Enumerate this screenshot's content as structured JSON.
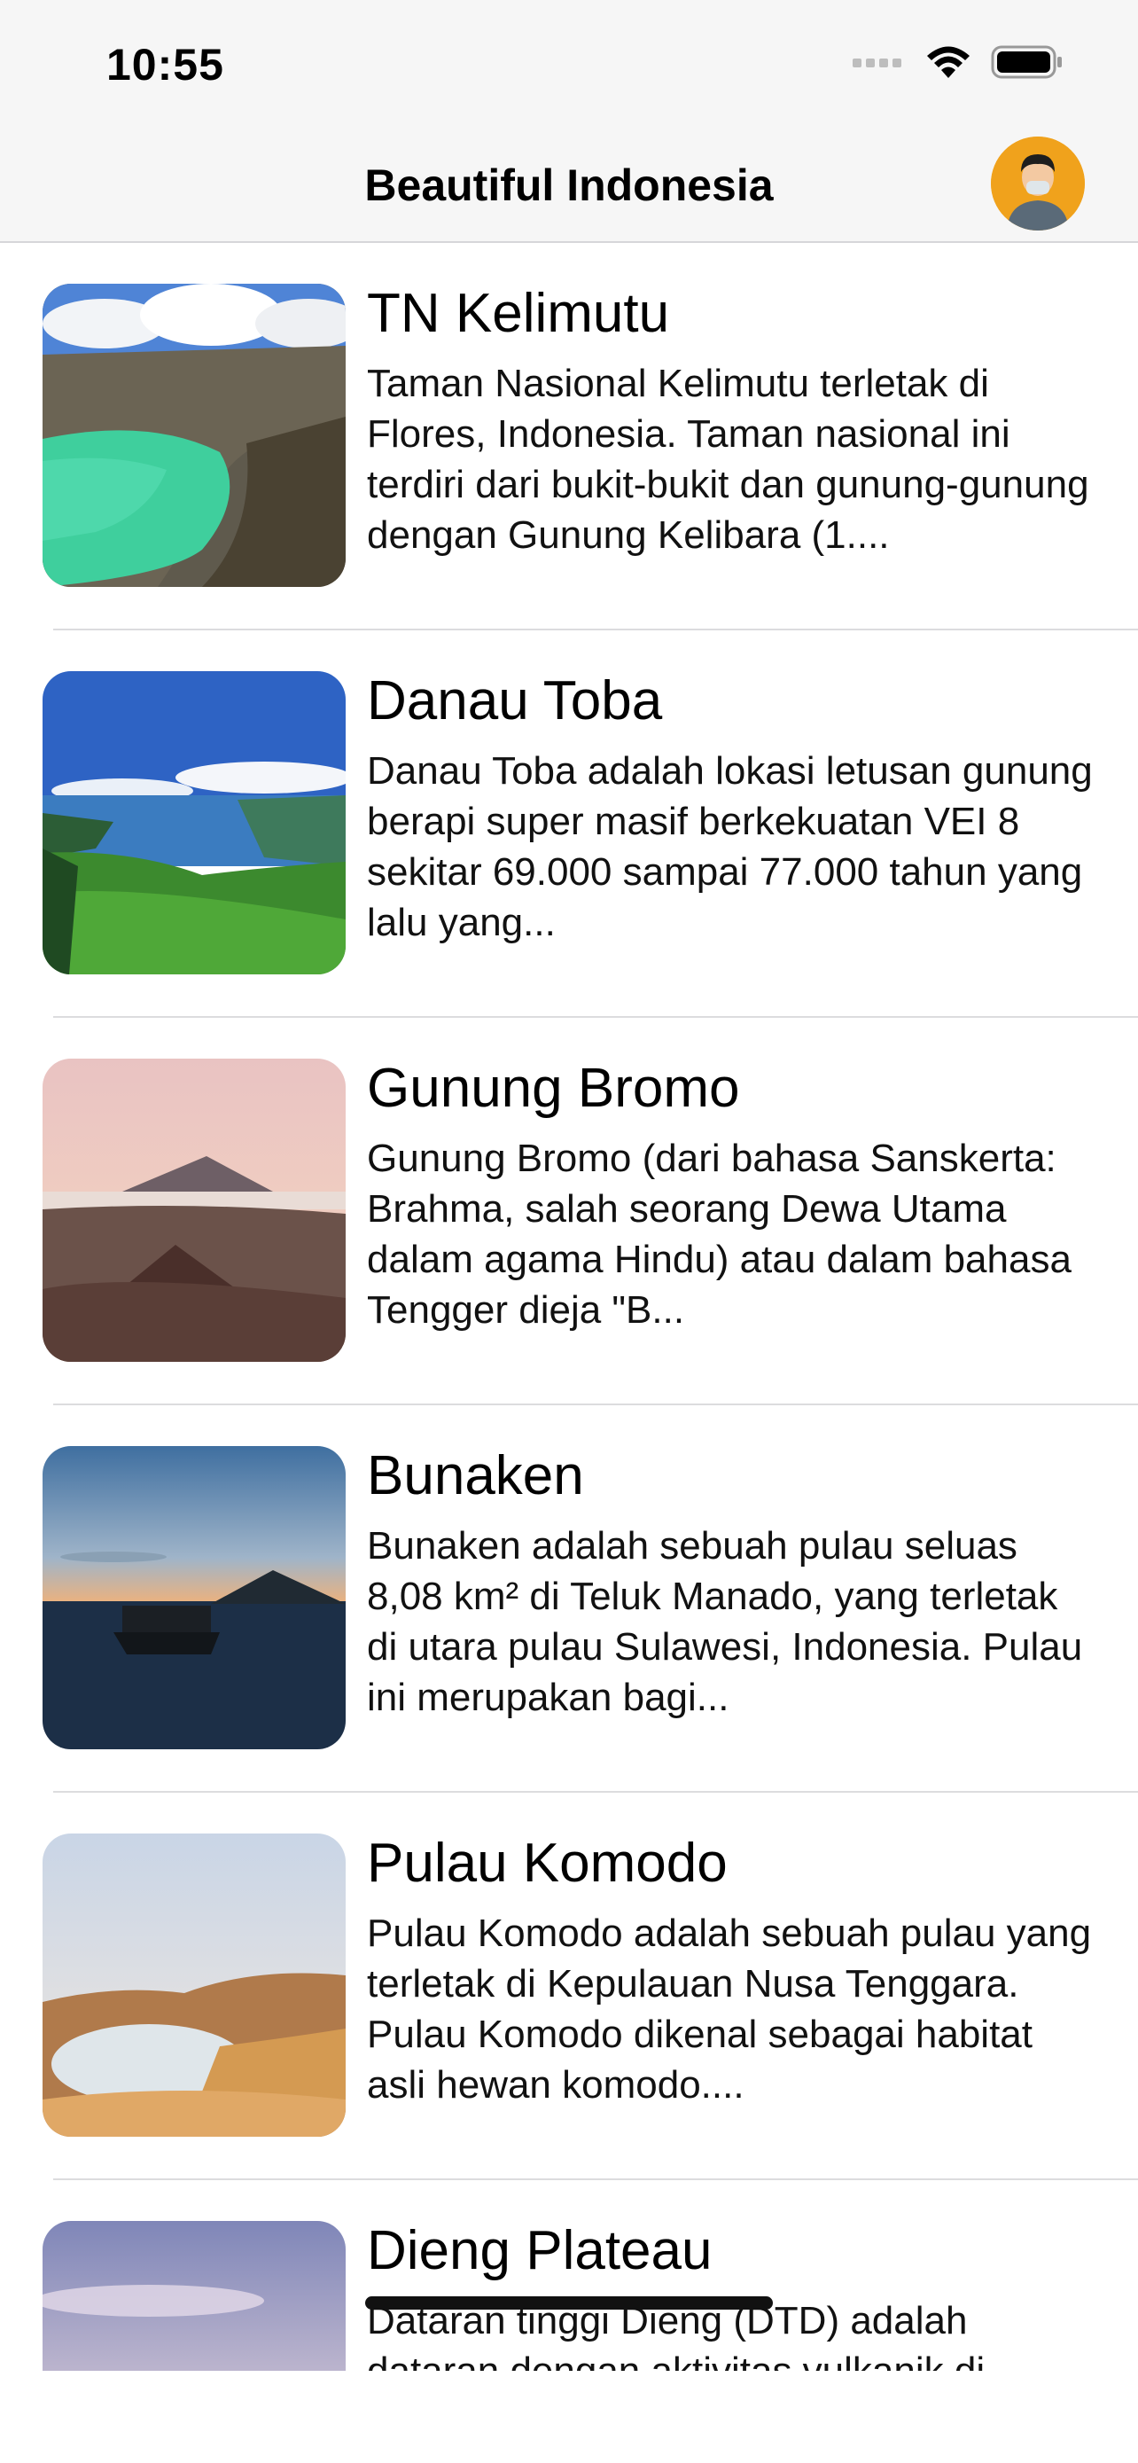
{
  "status_bar": {
    "time": "10:55"
  },
  "nav": {
    "title": "Beautiful Indonesia"
  },
  "items": [
    {
      "title": "TN Kelimutu",
      "description": "Taman Nasional Kelimutu terletak di Flores, Indonesia. Taman nasional ini terdiri dari bukit-bukit dan gunung-gunung dengan Gunung Kelibara (1....",
      "image": "kelimutu-crater-lake"
    },
    {
      "title": "Danau Toba",
      "description": "Danau Toba adalah lokasi letusan gunung berapi super masif berkekuatan VEI 8 sekitar 69.000 sampai 77.000 tahun yang lalu yang...",
      "image": "toba-lake"
    },
    {
      "title": "Gunung Bromo",
      "description": "Gunung Bromo (dari bahasa Sanskerta: Brahma, salah seorang Dewa Utama dalam agama Hindu) atau dalam bahasa Tengger dieja \"B...",
      "image": "bromo-volcano"
    },
    {
      "title": "Bunaken",
      "description": "Bunaken adalah sebuah pulau seluas 8,08 km² di Teluk Manado, yang terletak di utara pulau Sulawesi, Indonesia. Pulau ini merupakan bagi...",
      "image": "bunaken-boat-sunset"
    },
    {
      "title": "Pulau Komodo",
      "description": "Pulau Komodo adalah sebuah pulau yang terletak di Kepulauan Nusa Tenggara. Pulau Komodo dikenal sebagai habitat asli hewan komodo....",
      "image": "komodo-hills"
    },
    {
      "title": "Dieng Plateau",
      "description": "Dataran tinggi Dieng (DTD) adalah dataran dengan aktivitas vulkanik di bawah permukaannya...",
      "image": "dieng-sky"
    }
  ]
}
